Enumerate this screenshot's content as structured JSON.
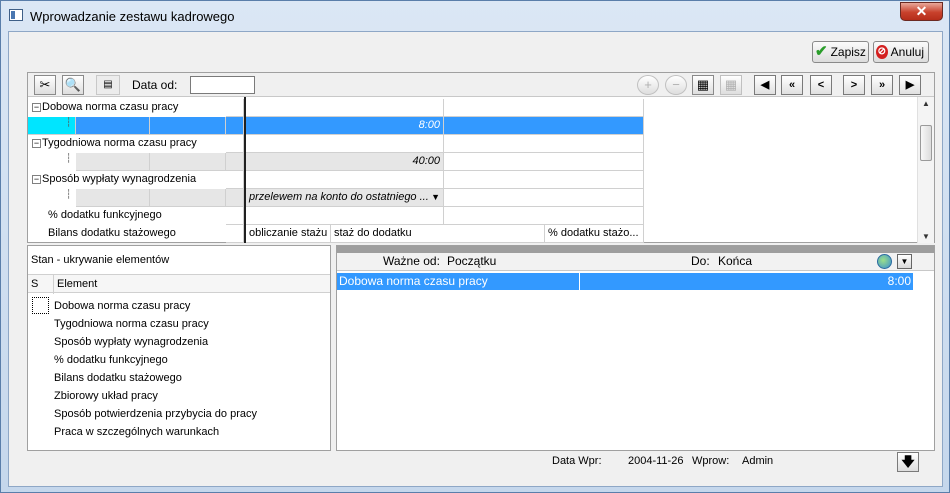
{
  "window": {
    "title": "Wprowadzanie zestawu kadrowego",
    "close": "✕"
  },
  "actions": {
    "save": "Zapisz",
    "cancel": "Anuluj"
  },
  "toolbar": {
    "date_label": "Data od:",
    "date_value": ""
  },
  "nav": {
    "first": "◀",
    "prev_many": "«",
    "prev": "<",
    "next": ">",
    "next_many": "»",
    "last": "▶"
  },
  "grid": {
    "rows": [
      {
        "label": "Dobowa norma czasu pracy",
        "expander": "−"
      },
      {
        "value": "8:00"
      },
      {
        "label": "Tygodniowa norma czasu pracy",
        "expander": "−"
      },
      {
        "value": "40:00"
      },
      {
        "label": "Sposób wypłaty wynagrodzenia",
        "expander": "−"
      },
      {
        "value": "przelewem na konto do ostatniego ..."
      },
      {
        "label": "% dodatku funkcyjnego"
      },
      {
        "label": "Bilans dodatku stażowego",
        "col1": "obliczanie stażu",
        "col2": "staż do dodatku",
        "col3": "% dodatku stażo..."
      }
    ]
  },
  "left_panel": {
    "title": "Stan - ukrywanie elementów",
    "col_s": "S",
    "col_element": "Element",
    "items": [
      "Dobowa norma czasu pracy",
      "Tygodniowa norma czasu pracy",
      "Sposób wypłaty wynagrodzenia",
      "% dodatku funkcyjnego",
      "Bilans dodatku stażowego",
      "Zbiorowy układ pracy",
      "Sposób potwierdzenia przybycia do pracy",
      "Praca w szczególnych warunkach"
    ]
  },
  "right_panel": {
    "valid_from_label": "Ważne od:",
    "valid_from": "Początku",
    "to_label": "Do:",
    "to": "Końca",
    "row_name": "Dobowa norma czasu pracy",
    "row_value": "8:00"
  },
  "footer": {
    "date_label": "Data Wpr:",
    "date": "2004-11-26",
    "user_label": "Wprow:",
    "user": "Admin"
  }
}
